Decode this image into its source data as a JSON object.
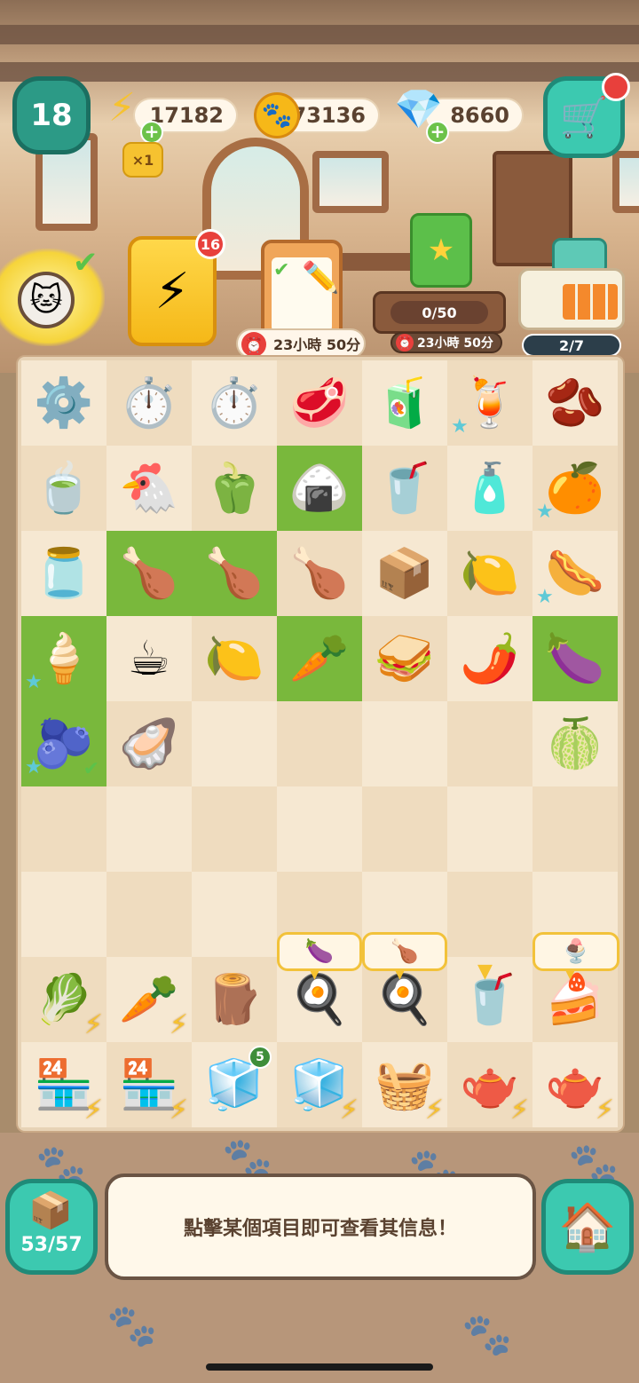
{
  "hud": {
    "level": "18",
    "energy": "17182",
    "energy_multiplier": "×1",
    "coins": "73136",
    "gems": "8660"
  },
  "quests": {
    "energy_card_count": "16",
    "timer_1": "23小時 50分",
    "event_progress": "0/50",
    "timer_2": "23小時 50分",
    "register_progress": "2/7"
  },
  "icons": {
    "energy": "lightning-icon",
    "coin": "paw-coin-icon",
    "gem": "gem-icon",
    "shop": "shop-cart-icon",
    "home": "home-icon",
    "inventory": "storage-box-icon"
  },
  "board": {
    "rows": [
      [
        {
          "name": "gear-cookie",
          "glyph": "⚙️",
          "bg": "light"
        },
        {
          "name": "stopwatch",
          "glyph": "⏱️",
          "bg": "dark"
        },
        {
          "name": "stopwatch",
          "glyph": "⏱️",
          "bg": "light"
        },
        {
          "name": "salami",
          "glyph": "🥩",
          "bg": "dark"
        },
        {
          "name": "grape-juice-bottle",
          "glyph": "🧃",
          "bg": "light"
        },
        {
          "name": "strawberry-smoothie",
          "glyph": "🍹",
          "bg": "dark",
          "star": true
        },
        {
          "name": "coffee-beans",
          "glyph": "🫘",
          "bg": "light"
        }
      ],
      [
        {
          "name": "green-tea-cup",
          "glyph": "🍵",
          "bg": "dark"
        },
        {
          "name": "chicken-timer",
          "glyph": "🐔",
          "bg": "light"
        },
        {
          "name": "bell-pepper",
          "glyph": "🫑",
          "bg": "dark"
        },
        {
          "name": "rice-rolls",
          "glyph": "🍙",
          "bg": "green"
        },
        {
          "name": "energy-drink",
          "glyph": "🥤",
          "bg": "dark"
        },
        {
          "name": "soda-bottle",
          "glyph": "🧴",
          "bg": "light"
        },
        {
          "name": "orange-juice",
          "glyph": "🍊",
          "bg": "dark",
          "star": true
        }
      ],
      [
        {
          "name": "coffee-jar",
          "glyph": "🫙",
          "bg": "light"
        },
        {
          "name": "chicken-breast",
          "glyph": "🍗",
          "bg": "green"
        },
        {
          "name": "chicken-breast",
          "glyph": "🍗",
          "bg": "green"
        },
        {
          "name": "drumstick",
          "glyph": "🍗",
          "bg": "dark"
        },
        {
          "name": "matcha-box",
          "glyph": "📦",
          "bg": "light"
        },
        {
          "name": "lemons",
          "glyph": "🍋",
          "bg": "dark"
        },
        {
          "name": "sausage-plate",
          "glyph": "🌭",
          "bg": "light",
          "star": true
        }
      ],
      [
        {
          "name": "cream-dessert",
          "glyph": "🍦",
          "bg": "green",
          "star": true
        },
        {
          "name": "black-tea",
          "glyph": "☕",
          "bg": "light"
        },
        {
          "name": "limes",
          "glyph": "🍋",
          "bg": "dark"
        },
        {
          "name": "carrot",
          "glyph": "🥕",
          "bg": "green"
        },
        {
          "name": "sandwich-stack",
          "glyph": "🥪",
          "bg": "dark"
        },
        {
          "name": "chili-pepper",
          "glyph": "🌶️",
          "bg": "light"
        },
        {
          "name": "eggplant",
          "glyph": "🍆",
          "bg": "green"
        }
      ],
      [
        {
          "name": "blueberry-smoothie",
          "glyph": "🫐",
          "bg": "green",
          "star": true,
          "tick": true
        },
        {
          "name": "oyster",
          "glyph": "🦪",
          "bg": "dark"
        },
        {
          "name": "empty",
          "glyph": "",
          "bg": "light"
        },
        {
          "name": "empty",
          "glyph": "",
          "bg": "dark"
        },
        {
          "name": "empty",
          "glyph": "",
          "bg": "light"
        },
        {
          "name": "empty",
          "glyph": "",
          "bg": "dark"
        },
        {
          "name": "green-lime",
          "glyph": "🍈",
          "bg": "light"
        }
      ],
      [
        {
          "name": "empty",
          "glyph": "",
          "bg": "dark"
        },
        {
          "name": "empty",
          "glyph": "",
          "bg": "light"
        },
        {
          "name": "empty",
          "glyph": "",
          "bg": "dark"
        },
        {
          "name": "empty",
          "glyph": "",
          "bg": "light"
        },
        {
          "name": "empty",
          "glyph": "",
          "bg": "dark"
        },
        {
          "name": "empty",
          "glyph": "",
          "bg": "light"
        },
        {
          "name": "empty",
          "glyph": "",
          "bg": "dark"
        }
      ],
      [
        {
          "name": "empty",
          "glyph": "",
          "bg": "light"
        },
        {
          "name": "empty",
          "glyph": "",
          "bg": "dark"
        },
        {
          "name": "empty",
          "glyph": "",
          "bg": "light"
        },
        {
          "name": "empty",
          "glyph": "",
          "bg": "dark"
        },
        {
          "name": "empty",
          "glyph": "",
          "bg": "light"
        },
        {
          "name": "empty",
          "glyph": "",
          "bg": "dark"
        },
        {
          "name": "empty",
          "glyph": "",
          "bg": "light"
        }
      ],
      [
        {
          "name": "vegetable-crate",
          "glyph": "🥬",
          "bg": "dark",
          "bolt": true
        },
        {
          "name": "carrot-crate",
          "glyph": "🥕",
          "bg": "light",
          "bolt": true
        },
        {
          "name": "cutting-board-stand",
          "glyph": "🪵",
          "bg": "dark"
        },
        {
          "name": "deep-fryer",
          "glyph": "🍳",
          "bg": "light",
          "arrow": true
        },
        {
          "name": "frying-pan",
          "glyph": "🍳",
          "bg": "dark",
          "arrow": true
        },
        {
          "name": "blender",
          "glyph": "🥤",
          "bg": "light",
          "arrow": true
        },
        {
          "name": "dessert-table",
          "glyph": "🍰",
          "bg": "dark",
          "arrow": true
        }
      ],
      [
        {
          "name": "juice-stand",
          "glyph": "🏪",
          "bg": "light",
          "bolt": true
        },
        {
          "name": "drink-dispenser",
          "glyph": "🏪",
          "bg": "dark",
          "bolt": true
        },
        {
          "name": "blue-fridge",
          "glyph": "🧊",
          "bg": "light",
          "count": "5"
        },
        {
          "name": "blue-fridge",
          "glyph": "🧊",
          "bg": "dark",
          "bolt": true
        },
        {
          "name": "fruit-basket",
          "glyph": "🧺",
          "bg": "light",
          "bolt": true
        },
        {
          "name": "tea-cart",
          "glyph": "🫖",
          "bg": "dark",
          "bolt": true
        },
        {
          "name": "tea-cart",
          "glyph": "🫖",
          "bg": "light",
          "bolt": true
        }
      ]
    ]
  },
  "order_tabs": [
    {
      "name": "order-eggplant",
      "glyph": "🍆"
    },
    {
      "name": "order-chicken-breast",
      "glyph": "🍗"
    },
    {
      "name": "order-dessert-set",
      "glyph": "🍨"
    }
  ],
  "bottom": {
    "inventory_count": "53/57",
    "info_text": "點擊某個項目即可查看其信息！"
  }
}
